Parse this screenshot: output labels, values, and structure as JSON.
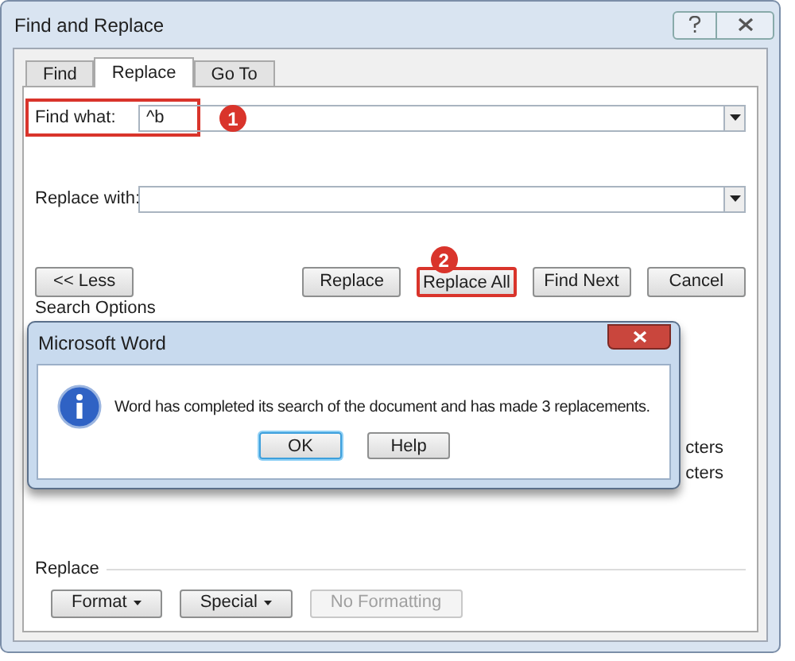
{
  "window": {
    "title": "Find and Replace"
  },
  "tabs": [
    {
      "label": "Find",
      "selected": false
    },
    {
      "label": "Replace",
      "selected": true
    },
    {
      "label": "Go To",
      "selected": false
    }
  ],
  "fields": [
    {
      "label": "Find what:",
      "value": "^b",
      "highlighted": true,
      "callout": "1"
    },
    {
      "label": "Replace with:",
      "highlighted": false
    }
  ],
  "buttons": [
    {
      "label": "<< Less",
      "highlighted": false
    },
    {
      "label": "Replace",
      "highlighted": false
    },
    {
      "label": "Replace All",
      "highlighted": true,
      "callout": "2"
    },
    {
      "label": "Find Next",
      "highlighted": false
    },
    {
      "label": "Cancel",
      "highlighted": false
    }
  ],
  "search_options": {
    "title": "Search Options",
    "partial_options": [
      "cters",
      "cters"
    ]
  },
  "replace_section": {
    "title": "Replace",
    "buttons": [
      {
        "label": "Format",
        "dropdown": true,
        "disabled": false
      },
      {
        "label": "Special",
        "dropdown": true,
        "disabled": false
      },
      {
        "label": "No Formatting",
        "dropdown": false,
        "disabled": true
      }
    ]
  },
  "message_box": {
    "title": "Microsoft Word",
    "message": "Word has completed its search of the document and has made 3 replacements.",
    "buttons": [
      {
        "label": "OK",
        "default": true
      },
      {
        "label": "Help",
        "default": false
      }
    ]
  }
}
